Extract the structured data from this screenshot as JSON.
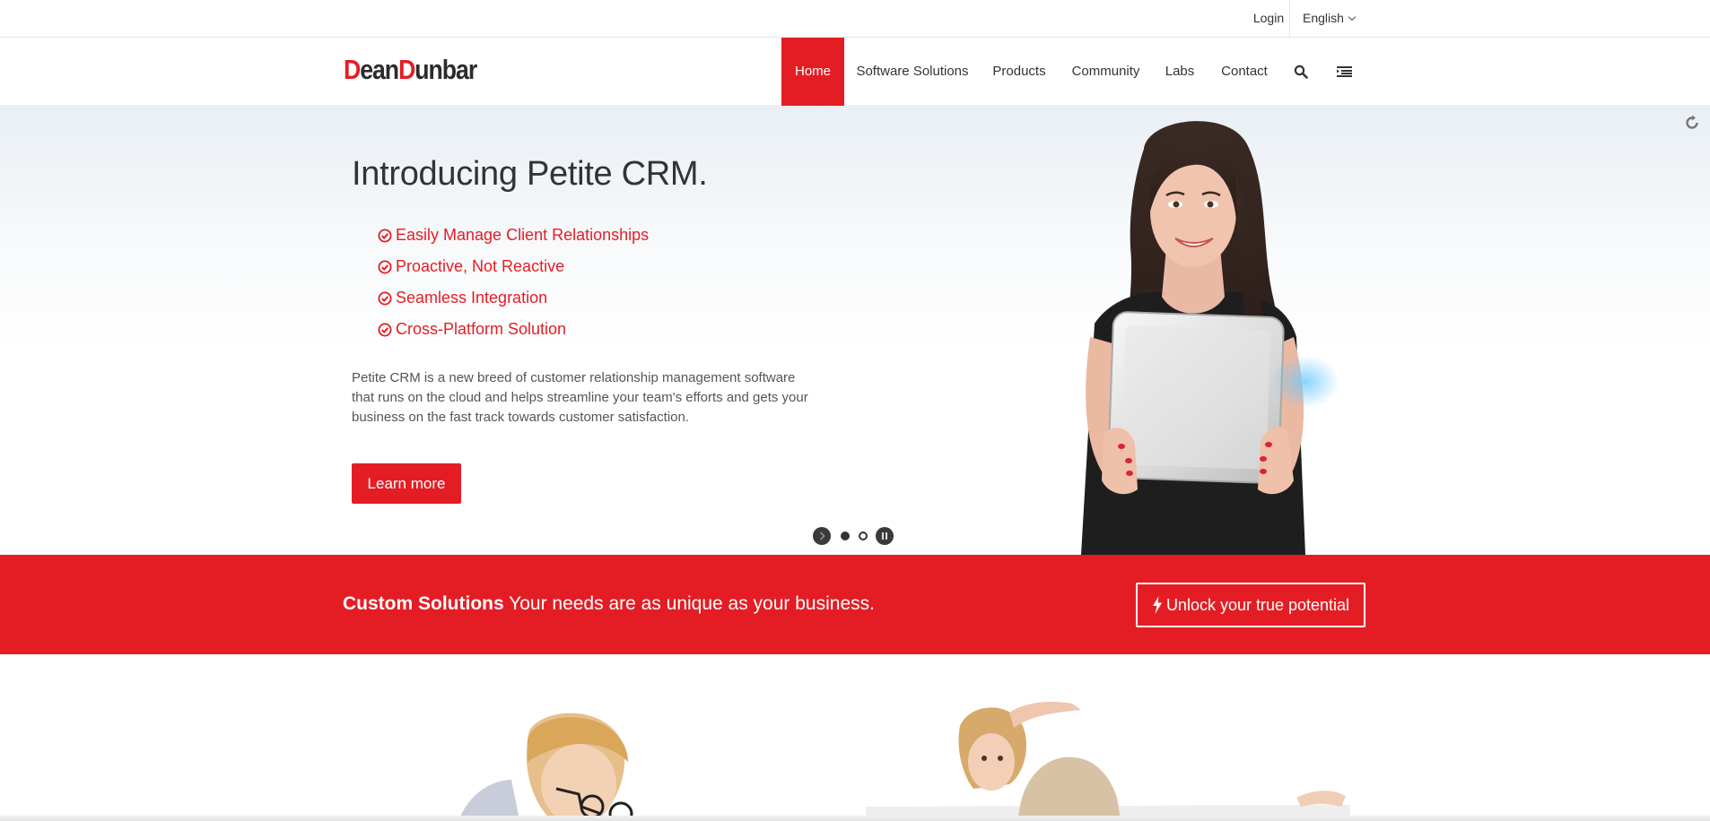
{
  "topbar": {
    "login_label": "Login",
    "language_label": "English"
  },
  "header": {
    "logo": {
      "part1_initial": "D",
      "part1_rest": "ean",
      "part2_initial": "D",
      "part2_rest": "unbar"
    },
    "nav": [
      {
        "label": "Home",
        "active": true
      },
      {
        "label": "Software Solutions",
        "active": false
      },
      {
        "label": "Products",
        "active": false
      },
      {
        "label": "Community",
        "active": false
      },
      {
        "label": "Labs",
        "active": false
      },
      {
        "label": "Contact",
        "active": false
      }
    ],
    "icons": [
      "search-icon",
      "menu-icon"
    ]
  },
  "hero": {
    "title": "Introducing Petite CRM.",
    "features": [
      "Easily Manage Client Relationships",
      "Proactive, Not Reactive",
      "Seamless Integration",
      "Cross-Platform Solution"
    ],
    "description": "Petite CRM is a new breed of customer relationship management software that runs on the cloud and helps streamline your team's efforts and gets your business on the fast track towards customer satisfaction.",
    "cta_label": "Learn more",
    "slider": {
      "slide_count": 2,
      "current_slide": 1,
      "paused": false
    }
  },
  "promo": {
    "bold_text": "Custom Solutions",
    "text": " Your needs are as unique as your business.",
    "cta_label": "Unlock your true potential"
  },
  "colors": {
    "accent": "#e41d25",
    "text": "#333333",
    "muted_text": "#555555"
  }
}
